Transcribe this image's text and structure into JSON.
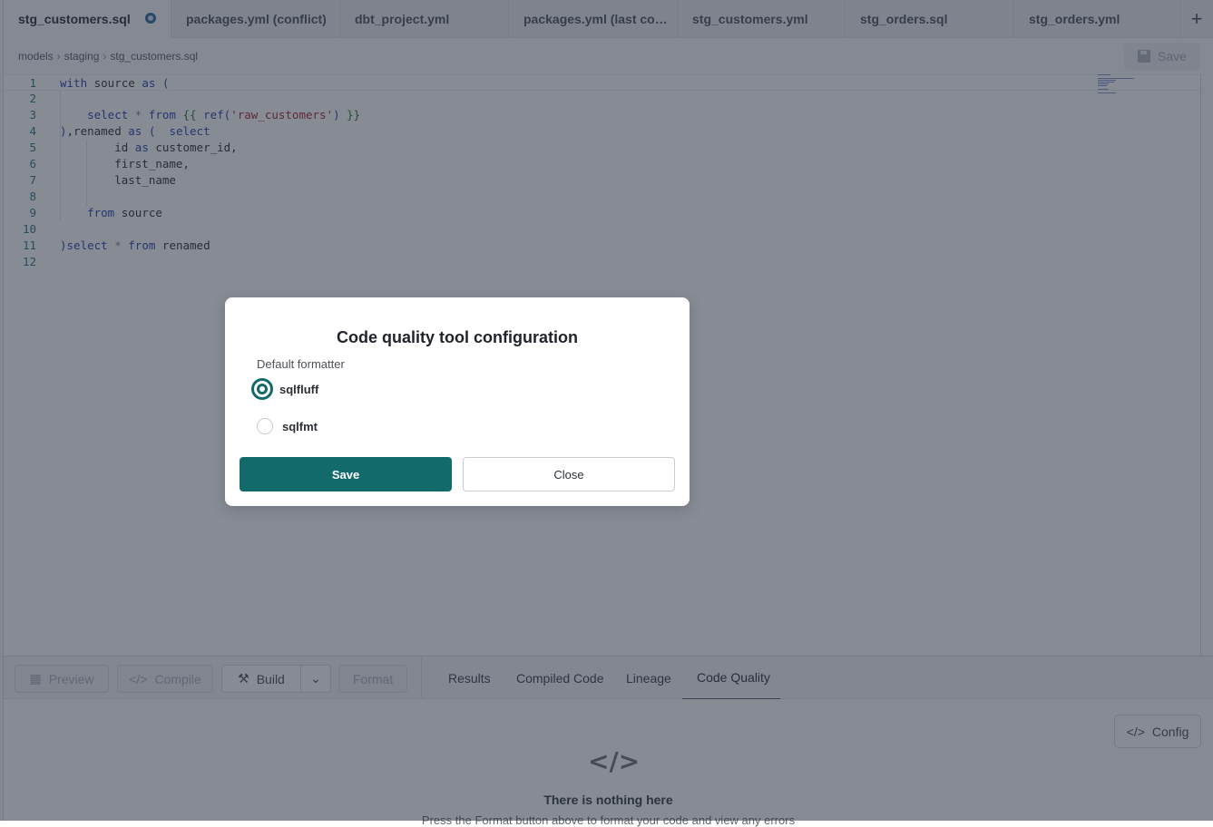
{
  "tabs": [
    {
      "label": "stg_customers.sql",
      "active": true,
      "unsaved": true
    },
    {
      "label": "packages.yml (conflict)"
    },
    {
      "label": "dbt_project.yml"
    },
    {
      "label": "packages.yml (last co…"
    },
    {
      "label": "stg_customers.yml"
    },
    {
      "label": "stg_orders.sql"
    },
    {
      "label": "stg_orders.yml"
    }
  ],
  "new_tab_icon": "plus-icon",
  "breadcrumb": [
    "models",
    "staging",
    "stg_customers.sql"
  ],
  "toolbar": {
    "save_label": "Save",
    "save_icon": "floppy-disk-icon"
  },
  "editor": {
    "line_numbers": [
      "1",
      "2",
      "3",
      "4",
      "5",
      "6",
      "7",
      "8",
      "9",
      "10",
      "11",
      "12"
    ],
    "lines": [
      "with source as (",
      "",
      "    select * from {{ ref('raw_customers') }}",
      "),renamed as (  select",
      "        id as customer_id,",
      "        first_name,",
      "        last_name",
      "",
      "    from source",
      "",
      ")select * from renamed",
      ""
    ]
  },
  "bottom_toolbar": {
    "preview": "Preview",
    "compile": "Compile",
    "build": "Build",
    "format": "Format",
    "tabs": [
      "Results",
      "Compiled Code",
      "Lineage",
      "Code Quality"
    ],
    "active_tab": "Code Quality"
  },
  "panel": {
    "config_label": "Config",
    "empty_title": "There is nothing here",
    "empty_subtitle": "Press the Format button above to format your code and view any errors"
  },
  "modal": {
    "title": "Code quality tool configuration",
    "field_label": "Default formatter",
    "options": [
      {
        "label": "sqlfluff",
        "selected": true
      },
      {
        "label": "sqlfmt",
        "selected": false
      }
    ],
    "save_label": "Save",
    "close_label": "Close"
  },
  "colors": {
    "accent": "#126a6b",
    "overlay": "rgba(33,41,58,0.54)"
  }
}
